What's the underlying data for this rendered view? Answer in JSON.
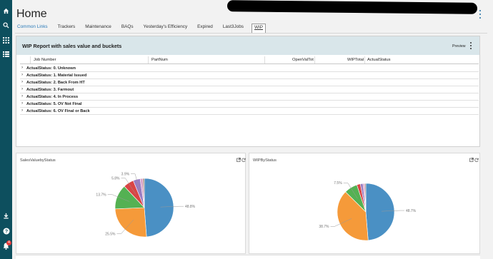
{
  "rail": {
    "icons": [
      "home-icon",
      "search-icon",
      "apps-grid-icon",
      "list-icon",
      "download-icon",
      "help-icon",
      "notifications-icon"
    ],
    "notification_count": "4"
  },
  "page": {
    "title": "Home"
  },
  "tabs": [
    {
      "label": "Common Links"
    },
    {
      "label": "Trackers"
    },
    {
      "label": "Maintenance"
    },
    {
      "label": "BAQs"
    },
    {
      "label": "Yesterday's Efficiency"
    },
    {
      "label": "Expired"
    },
    {
      "label": "Last3Jobs"
    },
    {
      "label": "WIP"
    }
  ],
  "wip_panel": {
    "title": "WIP Report with sales value and buckets",
    "preview_label": "Preview",
    "columns": [
      "Job Number",
      "PartNum",
      "OpenValTot",
      "WIPTotal",
      "ActualStatus"
    ],
    "groups": [
      "ActualStatus: 0. Unknown",
      "ActualStatus: 1. Material Issued",
      "ActualStatus: 2. Back From HT",
      "ActualStatus: 3. Farmout",
      "ActualStatus: 4. In Process",
      "ActualStatus: 5. OV Not Final",
      "ActualStatus: 6. OV Final or Back"
    ]
  },
  "charts": [
    {
      "title": "SalesValuebyStatus"
    },
    {
      "title": "WIPByStatus"
    }
  ],
  "chart_data": [
    {
      "type": "pie",
      "title": "SalesValuebyStatus",
      "series": [
        {
          "value": 48.8,
          "label": "48.8%",
          "color": "#4a90c4"
        },
        {
          "value": 25.5,
          "label": "25.5%",
          "color": "#f59a3a"
        },
        {
          "value": 13.7,
          "label": "13.7%",
          "color": "#54b153"
        },
        {
          "value": 5.8,
          "label": "5.8%",
          "color": "#d94545"
        },
        {
          "value": 3.9,
          "label": "3.9%",
          "color": "#9a7cc2"
        },
        {
          "value": 1.5,
          "label": "",
          "color": "#d9a0c8"
        },
        {
          "value": 0.8,
          "label": "",
          "color": "#9e7a6a"
        }
      ]
    },
    {
      "type": "pie",
      "title": "WIPByStatus",
      "series": [
        {
          "value": 48.7,
          "label": "48.7%",
          "color": "#4a90c4"
        },
        {
          "value": 38.7,
          "label": "38.7%",
          "color": "#f59a3a"
        },
        {
          "value": 7.5,
          "label": "7.5%",
          "color": "#54b153"
        },
        {
          "value": 2.0,
          "label": "",
          "color": "#d94545"
        },
        {
          "value": 1.5,
          "label": "",
          "color": "#9a7cc2"
        },
        {
          "value": 1.0,
          "label": "",
          "color": "#d9a0c8"
        },
        {
          "value": 0.6,
          "label": "",
          "color": "#9e7a6a"
        }
      ]
    }
  ]
}
